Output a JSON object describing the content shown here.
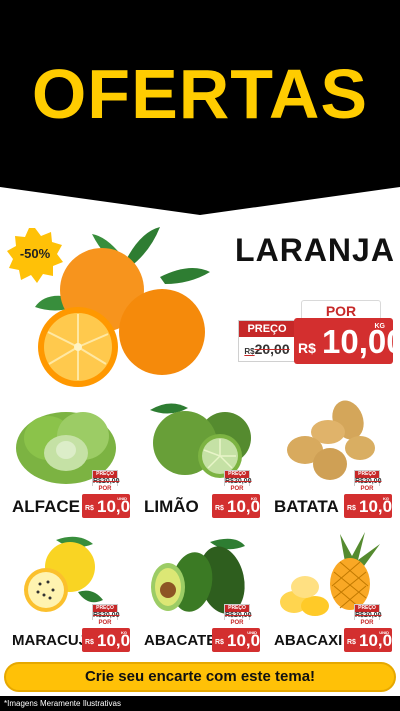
{
  "header": {
    "title": "OFERTAS"
  },
  "hero": {
    "discount": "-50%",
    "name": "LARANJA",
    "por_label": "POR",
    "preco_label": "PREÇO",
    "old_currency": "R$",
    "old_value": "20,00",
    "currency": "R$",
    "value": "10,00",
    "unit": "KG"
  },
  "products": [
    {
      "name": "ALFACE",
      "preco_label": "PREÇO",
      "old_price": "R$20,00",
      "por_label": "POR",
      "currency": "R$",
      "value": "10,00",
      "unit": "UNID"
    },
    {
      "name": "LIMÃO",
      "preco_label": "PREÇO",
      "old_price": "R$20,00",
      "por_label": "POR",
      "currency": "R$",
      "value": "10,00",
      "unit": "KG"
    },
    {
      "name": "BATATA",
      "preco_label": "PREÇO",
      "old_price": "R$20,00",
      "por_label": "POR",
      "currency": "R$",
      "value": "10,00",
      "unit": "KG"
    },
    {
      "name": "MARACUJÁ",
      "preco_label": "PREÇO",
      "old_price": "R$20,00",
      "por_label": "POR",
      "currency": "R$",
      "value": "10,00",
      "unit": "KG"
    },
    {
      "name": "ABACATE",
      "preco_label": "PREÇO",
      "old_price": "R$20,00",
      "por_label": "POR",
      "currency": "R$",
      "value": "10,00",
      "unit": "UNID"
    },
    {
      "name": "ABACAXI",
      "preco_label": "PREÇO",
      "old_price": "R$20,00",
      "por_label": "POR",
      "currency": "R$",
      "value": "10,00",
      "unit": "UNID"
    }
  ],
  "cta": {
    "label": "Crie seu encarte com este tema!"
  },
  "disclaimer": "*Imagens Meramente Ilustrativas",
  "colors": {
    "accent": "#FFCC00",
    "price_red": "#D32F2F",
    "header_bg": "#000000",
    "cta_bg": "#FFC107"
  }
}
